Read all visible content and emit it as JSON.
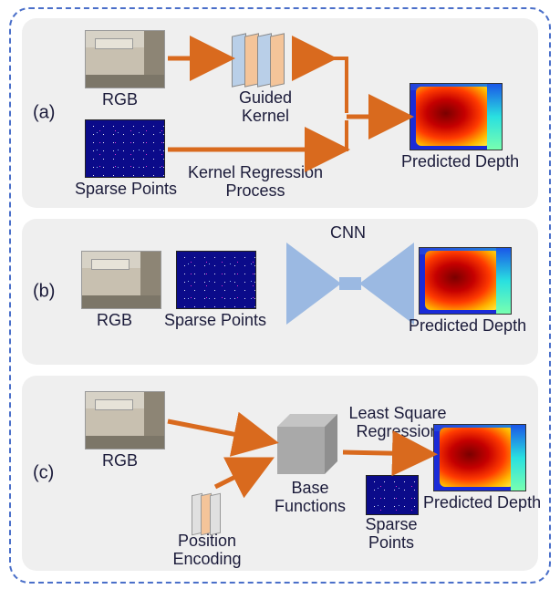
{
  "panels": {
    "a": {
      "label": "(a)"
    },
    "b": {
      "label": "(b)"
    },
    "c": {
      "label": "(c)"
    }
  },
  "labels": {
    "rgb": "RGB",
    "sparse_points": "Sparse Points",
    "sparse_points_2l": "Sparse\nPoints",
    "guided_kernel": "Guided\nKernel",
    "kernel_regression": "Kernel Regression\nProcess",
    "predicted_depth": "Predicted Depth",
    "cnn": "CNN",
    "position_encoding": "Position\nEncoding",
    "base_functions": "Base\nFunctions",
    "least_square_regression": "Least Square\nRegression"
  }
}
